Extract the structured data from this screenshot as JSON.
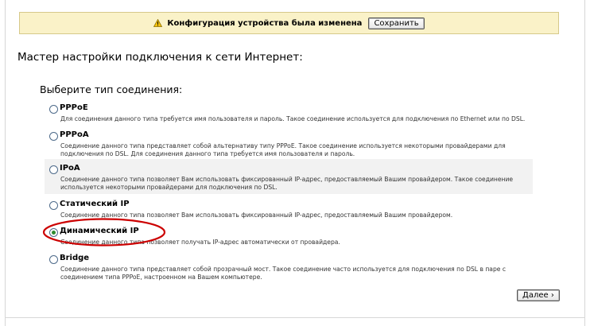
{
  "banner": {
    "message": "Конфигурация устройства была изменена",
    "save_label": "Сохранить"
  },
  "page": {
    "title": "Мастер настройки подключения к сети Интернет:",
    "section_title": "Выберите тип соединения:"
  },
  "options": [
    {
      "label": "PPPoE",
      "description": "Для соединения данного типа требуется имя пользователя и пароль. Такое соединение используется для подключения по Ethernet или по DSL.",
      "selected": false
    },
    {
      "label": "PPPoA",
      "description": "Соединение данного типа представляет собой альтернативу типу PPPoE. Такое соединение используется некоторыми провайдерами для подключения по DSL. Для соединения данного типа требуется имя пользователя и пароль.",
      "selected": false
    },
    {
      "label": "IPoA",
      "description": "Соединение данного типа позволяет Вам использовать фиксированный IP-адрес, предоставляемый Вашим провайдером. Такое соединение используется некоторыми провайдерами для подключения по DSL.",
      "selected": false
    },
    {
      "label": "Статический IP",
      "description": "Соединение данного типа позволяет Вам использовать фиксированный IP-адрес, предоставляемый Вашим провайдером.",
      "selected": false
    },
    {
      "label": "Динамический IP",
      "description": "Соединение данного типа позволяет получать IP-адрес автоматически от провайдера.",
      "selected": true
    },
    {
      "label": "Bridge",
      "description": "Соединение данного типа представляет собой прозрачный мост. Такое соединение часто используется для подключения по DSL в паре с соединением типа PPPoE, настроенном на Вашем компьютере.",
      "selected": false
    }
  ],
  "footer": {
    "next_label": "Далее ›"
  },
  "colors": {
    "banner_bg": "#faf2c8",
    "highlight": "#cc0000",
    "radio_checked": "#2e8b2e"
  },
  "icons": {
    "banner": "warning-icon"
  }
}
